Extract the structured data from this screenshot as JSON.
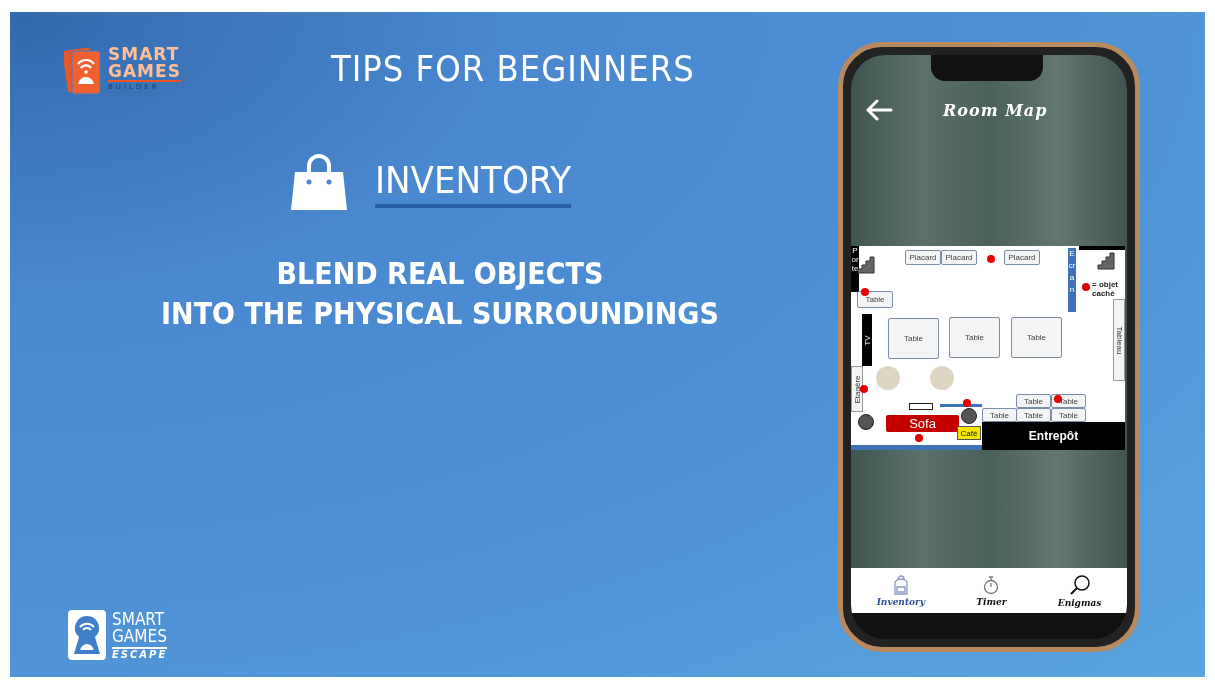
{
  "logo_top": {
    "lines": [
      "SMART",
      "GAMES",
      "BUILDER"
    ]
  },
  "title": "TIPS FOR BEGINNERS",
  "section": {
    "heading": "INVENTORY"
  },
  "body": [
    "BLEND REAL OBJECTS",
    "INTO THE PHYSICAL SURROUNDINGS"
  ],
  "logo_bottom": {
    "lines": [
      "SMART",
      "GAMES",
      "ESCAPE"
    ]
  },
  "phone": {
    "header": {
      "title": "Room Map"
    },
    "map": {
      "porte": "Porte",
      "placards": [
        "Placard",
        "Placard",
        "Placard"
      ],
      "ecran": "Ecran",
      "legend": "= objet caché",
      "side_table": "Table",
      "tv": "TV",
      "tables": [
        "Table",
        "Table",
        "Table"
      ],
      "tableau": "Tableau",
      "etagere": "Etagère",
      "lower_tables": [
        "Table",
        "Table",
        "Table",
        "Table",
        "Table"
      ],
      "sofa": "Sofa",
      "cafe": "Café",
      "entrepot": "Entrepôt"
    },
    "nav": [
      {
        "label": "Inventory",
        "selected": true
      },
      {
        "label": "Timer",
        "selected": false
      },
      {
        "label": "Enigmas",
        "selected": false
      }
    ]
  }
}
